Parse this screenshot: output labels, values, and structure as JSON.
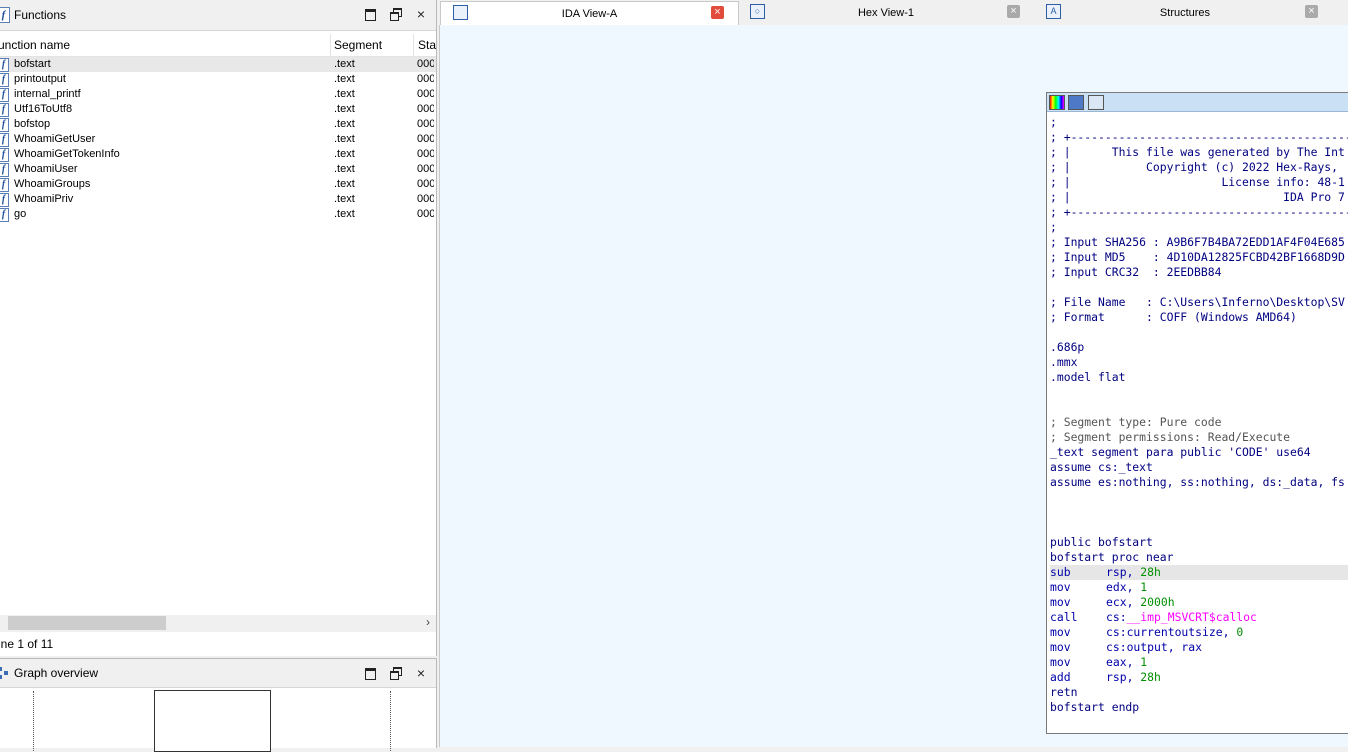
{
  "functions_panel": {
    "title": "Functions",
    "columns": {
      "name": "unction name",
      "segment": "Segment",
      "start": "Sta"
    },
    "rows": [
      {
        "name": "bofstart",
        "segment": ".text",
        "start": "000"
      },
      {
        "name": "printoutput",
        "segment": ".text",
        "start": "000"
      },
      {
        "name": "internal_printf",
        "segment": ".text",
        "start": "000"
      },
      {
        "name": "Utf16ToUtf8",
        "segment": ".text",
        "start": "000"
      },
      {
        "name": "bofstop",
        "segment": ".text",
        "start": "000"
      },
      {
        "name": "WhoamiGetUser",
        "segment": ".text",
        "start": "000"
      },
      {
        "name": "WhoamiGetTokenInfo",
        "segment": ".text",
        "start": "000"
      },
      {
        "name": "WhoamiUser",
        "segment": ".text",
        "start": "000"
      },
      {
        "name": "WhoamiGroups",
        "segment": ".text",
        "start": "000"
      },
      {
        "name": "WhoamiPriv",
        "segment": ".text",
        "start": "000"
      },
      {
        "name": "go",
        "segment": ".text",
        "start": "000"
      }
    ],
    "status": "ine 1 of 11",
    "icon_letter": "f",
    "max_glyph": "",
    "close_glyph": "×",
    "scroll_right_glyph": "›"
  },
  "graph_panel": {
    "title": "Graph overview"
  },
  "tabs": [
    {
      "label": "IDA View-A",
      "active": true,
      "icon": ""
    },
    {
      "label": "Hex View-1",
      "active": false,
      "icon": "○"
    },
    {
      "label": "Structures",
      "active": false,
      "icon": "A"
    }
  ],
  "code_lines": [
    {
      "t": ";",
      "cls": "c-blk"
    },
    {
      "t": "; +-------------------------------------------------",
      "cls": "c-blk"
    },
    {
      "t": "; |      This file was generated by The Int",
      "cls": "c-blk"
    },
    {
      "t": "; |           Copyright (c) 2022 Hex-Rays,",
      "cls": "c-blk"
    },
    {
      "t": "; |                      License info: 48-1",
      "cls": "c-blk"
    },
    {
      "t": "; |                               IDA Pro 7",
      "cls": "c-blk"
    },
    {
      "t": "; +-------------------------------------------------",
      "cls": "c-blk"
    },
    {
      "t": ";",
      "cls": "c-blk"
    },
    {
      "t": "; Input SHA256 : A9B6F7B4BA72EDD1AF4F04E685",
      "cls": "c-blk"
    },
    {
      "t": "; Input MD5    : 4D10DA12825FCBD42BF1668D9D",
      "cls": "c-blk"
    },
    {
      "t": "; Input CRC32  : 2EEDBB84",
      "cls": "c-blk"
    },
    {
      "t": "",
      "cls": ""
    },
    {
      "t": "; File Name   : C:\\Users\\Inferno\\Desktop\\SV",
      "cls": "c-blk"
    },
    {
      "t": "; Format      : COFF (Windows AMD64)",
      "cls": "c-blk"
    },
    {
      "t": "",
      "cls": ""
    },
    {
      "t": ".686p",
      "cls": "c-blk"
    },
    {
      "t": ".mmx",
      "cls": "c-blk"
    },
    {
      "t": ".model flat",
      "cls": "c-blk"
    },
    {
      "t": "",
      "cls": ""
    },
    {
      "t": "",
      "cls": ""
    },
    {
      "t": "; Segment type: Pure code",
      "cls": "c-com"
    },
    {
      "t": "; Segment permissions: Read/Execute",
      "cls": "c-com"
    },
    {
      "t": "_text segment para public 'CODE' use64",
      "cls": "c-blk"
    },
    {
      "t": "assume cs:_text",
      "cls": "c-blk"
    },
    {
      "t": "assume es:nothing, ss:nothing, ds:_data, fs",
      "cls": "c-blk"
    },
    {
      "t": "",
      "cls": ""
    },
    {
      "t": "",
      "cls": ""
    },
    {
      "t": "",
      "cls": ""
    },
    {
      "t": "public bofstart",
      "cls": "c-blk"
    },
    {
      "t": "bofstart proc near",
      "cls": "c-blk"
    },
    {
      "mn": "sub",
      "op1": "rsp, ",
      "op2": "28h",
      "op2cls": "c-grn",
      "hl": true
    },
    {
      "mn": "mov",
      "op1": "edx, ",
      "op2": "1",
      "op2cls": "c-grn"
    },
    {
      "mn": "mov",
      "op1": "ecx, ",
      "op2": "2000h",
      "op2cls": "c-grn"
    },
    {
      "mn": "call",
      "op1": "cs:",
      "op2": "__imp_MSVCRT$calloc",
      "op2cls": "c-pnk"
    },
    {
      "mn": "mov",
      "op1": "cs:currentoutsize, ",
      "op2": "0",
      "op2cls": "c-grn"
    },
    {
      "mn": "mov",
      "op1": "cs:output, rax",
      "op2": "",
      "op2cls": ""
    },
    {
      "mn": "mov",
      "op1": "eax, ",
      "op2": "1",
      "op2cls": "c-grn"
    },
    {
      "mn": "add",
      "op1": "rsp, ",
      "op2": "28h",
      "op2cls": "c-grn"
    },
    {
      "t": "retn",
      "cls": "c-blk"
    },
    {
      "t": "bofstart endp",
      "cls": "c-blk"
    }
  ]
}
